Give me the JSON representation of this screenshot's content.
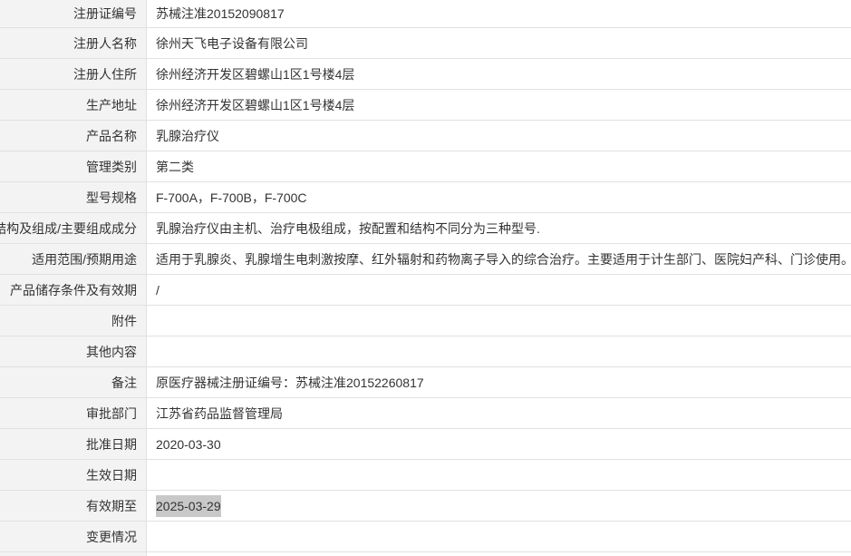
{
  "rows": [
    {
      "label": "注册证编号",
      "value": "苏械注准20152090817"
    },
    {
      "label": "注册人名称",
      "value": "徐州天飞电子设备有限公司"
    },
    {
      "label": "注册人住所",
      "value": "徐州经济开发区碧螺山1区1号楼4层"
    },
    {
      "label": "生产地址",
      "value": "徐州经济开发区碧螺山1区1号楼4层"
    },
    {
      "label": "产品名称",
      "value": "乳腺治疗仪"
    },
    {
      "label": "管理类别",
      "value": "第二类"
    },
    {
      "label": "型号规格",
      "value": "F-700A，F-700B，F-700C"
    },
    {
      "label": "结构及组成/主要组成成分",
      "value": "乳腺治疗仪由主机、治疗电极组成，按配置和结构不同分为三种型号."
    },
    {
      "label": "适用范围/预期用途",
      "value": "适用于乳腺炎、乳腺增生电刺激按摩、红外辐射和药物离子导入的综合治疗。主要适用于计生部门、医院妇产科、门诊使用。"
    },
    {
      "label": "产品储存条件及有效期",
      "value": "/"
    },
    {
      "label": "附件",
      "value": ""
    },
    {
      "label": "其他内容",
      "value": ""
    },
    {
      "label": "备注",
      "value": "原医疗器械注册证编号：苏械注准20152260817"
    },
    {
      "label": "审批部门",
      "value": "江苏省药品监督管理局"
    },
    {
      "label": "批准日期",
      "value": "2020-03-30"
    },
    {
      "label": "生效日期",
      "value": ""
    },
    {
      "label": "有效期至",
      "value": "2025-03-29"
    },
    {
      "label": "变更情况",
      "value": ""
    }
  ],
  "colors": {
    "label_bg": "#f3f3f3",
    "border": "#e1e1e1",
    "text": "#333333",
    "selection_bg": "#c8c8c8"
  }
}
